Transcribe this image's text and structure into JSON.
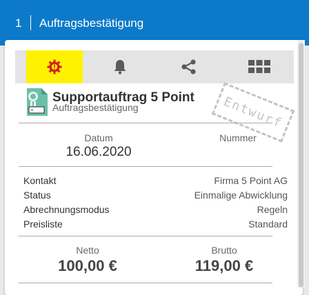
{
  "header": {
    "step_number": "1",
    "title": "Auftragsbestätigung",
    "bar_color": "#0c7ac9"
  },
  "toolbar": {
    "items": [
      {
        "icon": "status-gear-icon",
        "active": true
      },
      {
        "icon": "bell-icon",
        "active": false
      },
      {
        "icon": "share-icon",
        "active": false
      },
      {
        "icon": "grid-icon",
        "active": false
      }
    ],
    "active_color": "#fff200"
  },
  "document": {
    "title": "Supportauftrag 5 Point",
    "subtitle": "Auftragsbestätigung",
    "stamp": "Entwurf",
    "icon": "certificate-document-icon"
  },
  "meta": {
    "date_label": "Datum",
    "date_value": "16.06.2020",
    "number_label": "Nummer",
    "number_value": ""
  },
  "details": [
    {
      "label": "Kontakt",
      "value": "Firma 5 Point AG"
    },
    {
      "label": "Status",
      "value": "Einmalige Abwicklung"
    },
    {
      "label": "Abrechnungsmodus",
      "value": "Regeln"
    },
    {
      "label": "Preisliste",
      "value": "Standard"
    }
  ],
  "totals": {
    "net_label": "Netto",
    "net_value": "100,00 €",
    "gross_label": "Brutto",
    "gross_value": "119,00 €"
  }
}
